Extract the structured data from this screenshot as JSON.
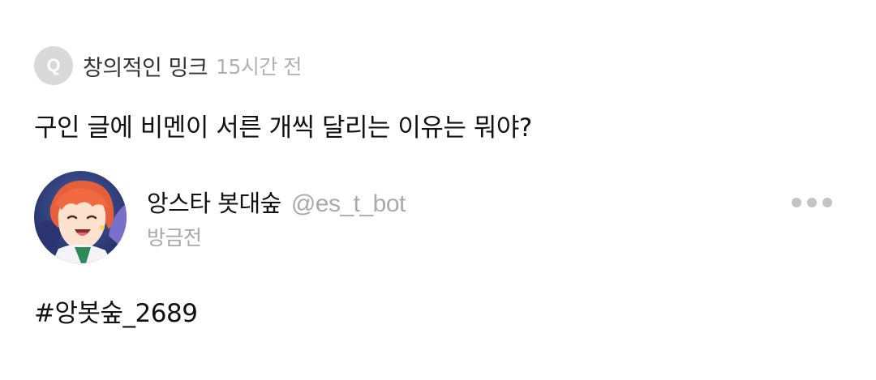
{
  "question": {
    "asker_avatar_letter": "Q",
    "asker_name": "창의적인 밍크",
    "asked_time": "15시간 전",
    "text": "구인 글에 비멘이 서른 개씩 달리는 이유는 뭐야?"
  },
  "answer": {
    "author_name": "앙스타 봇대숲",
    "author_handle": "@es_t_bot",
    "time": "방금전",
    "text": "#앙봇숲_2689",
    "avatar_icon": "anime-character-avatar",
    "more_icon": "more-dots-icon"
  },
  "colors": {
    "q_avatar_bg": "#d9d9d9",
    "muted_text": "#aaaaaa",
    "primary_text": "#111111",
    "dots": "#c4c4c4"
  }
}
